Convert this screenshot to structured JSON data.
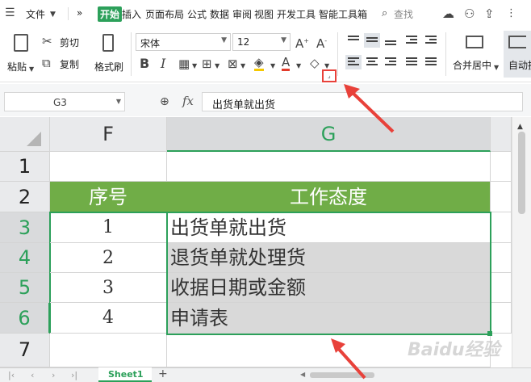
{
  "menu": {
    "file": "文件",
    "more": "»",
    "tabs": [
      "开始",
      "插入",
      "页面布局",
      "公式",
      "数据",
      "审阅",
      "视图",
      "开发工具",
      "智能工具箱"
    ],
    "search": "查找"
  },
  "ribbon": {
    "paste": "粘贴",
    "cut": "剪切",
    "copy": "复制",
    "format_painter": "格式刷",
    "font_name": "宋体",
    "font_size": "12",
    "merge_center": "合并居中",
    "auto_wrap": "自动换"
  },
  "formula_bar": {
    "name_box": "G3",
    "fx": "fx",
    "content": "出货单就出货"
  },
  "grid": {
    "columns": [
      "F",
      "G"
    ],
    "rows": [
      "1",
      "2",
      "3",
      "4",
      "5",
      "6",
      "7"
    ],
    "header_row": {
      "f": "序号",
      "g": "工作态度"
    },
    "data": [
      {
        "f": "1",
        "g": "出货单就出货"
      },
      {
        "f": "2",
        "g": "退货单就处理货"
      },
      {
        "f": "3",
        "g": "收据日期或金额"
      },
      {
        "f": "4",
        "g": "申请表"
      }
    ]
  },
  "sheet_tabs": {
    "active": "Sheet1",
    "add": "+"
  },
  "colors": {
    "accent": "#2ca05a",
    "header_fill": "#70ad47",
    "selection": "#d9d9d9",
    "arrow": "#e8413a"
  },
  "watermark": "Baidu经验"
}
